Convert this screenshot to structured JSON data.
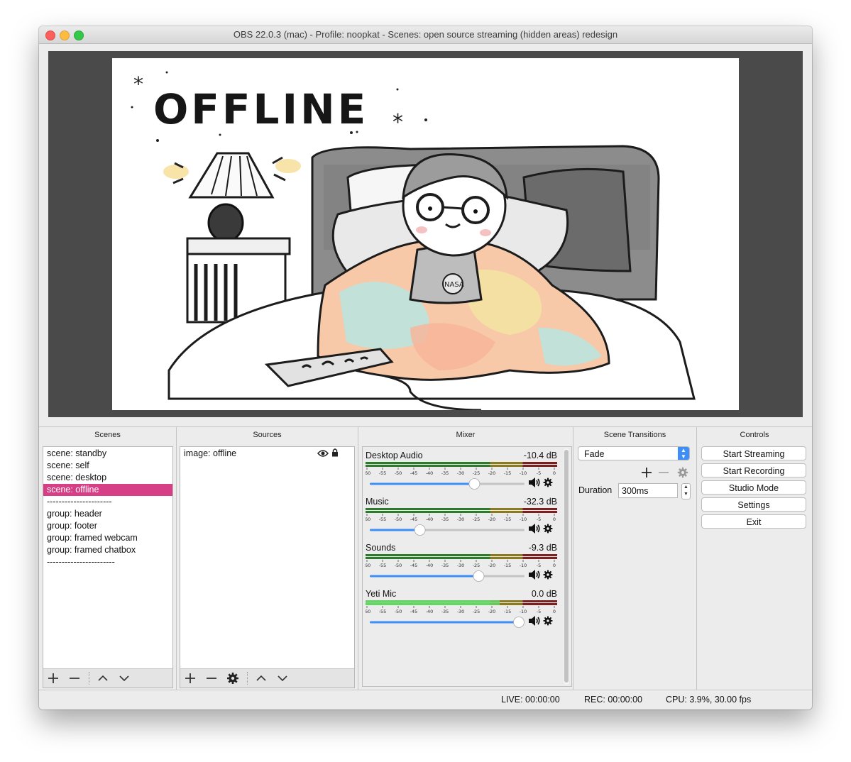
{
  "window": {
    "title": "OBS 22.0.3 (mac) - Profile: noopkat - Scenes: open source streaming (hidden areas) redesign"
  },
  "preview": {
    "image_text": "OFFLINE",
    "shirt_text": "NASA"
  },
  "scenes": {
    "title": "Scenes",
    "items": [
      {
        "label": "scene: standby"
      },
      {
        "label": "scene: self"
      },
      {
        "label": "scene: desktop"
      },
      {
        "label": "scene: offline"
      },
      {
        "label": "----------------------"
      },
      {
        "label": "group: header"
      },
      {
        "label": "group: footer"
      },
      {
        "label": "group: framed webcam"
      },
      {
        "label": "group: framed chatbox"
      },
      {
        "label": "-----------------------"
      }
    ],
    "selected_index": 3,
    "selected_color": "#d63e86"
  },
  "sources": {
    "title": "Sources",
    "items": [
      {
        "label": "image: offline",
        "visible_icon": "eye-icon",
        "lock_icon": "lock-icon"
      }
    ]
  },
  "mixer": {
    "title": "Mixer",
    "scale": [
      "-60",
      "-55",
      "-50",
      "-45",
      "-40",
      "-35",
      "-30",
      "-25",
      "-20",
      "-15",
      "-10",
      "-5",
      "0"
    ],
    "channels": [
      {
        "name": "Desktop Audio",
        "db": "-10.4 dB",
        "volume": 0.69,
        "level": 0.0
      },
      {
        "name": "Music",
        "db": "-32.3 dB",
        "volume": 0.31,
        "level": 0.0
      },
      {
        "name": "Sounds",
        "db": "-9.3 dB",
        "volume": 0.72,
        "level": 0.0
      },
      {
        "name": "Yeti Mic",
        "db": "0.0 dB",
        "volume": 1.0,
        "level": 0.7
      }
    ]
  },
  "transitions": {
    "title": "Scene Transitions",
    "selected": "Fade",
    "duration_label": "Duration",
    "duration_value": "300ms"
  },
  "controls": {
    "title": "Controls",
    "buttons": [
      "Start Streaming",
      "Start Recording",
      "Studio Mode",
      "Settings",
      "Exit"
    ]
  },
  "status": {
    "live": "LIVE: 00:00:00",
    "rec": "REC: 00:00:00",
    "cpu": "CPU: 3.9%, 30.00 fps"
  }
}
